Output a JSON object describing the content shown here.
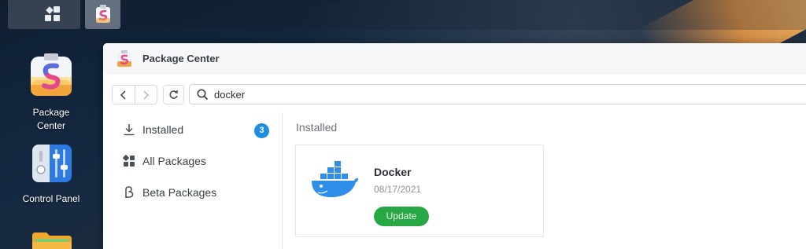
{
  "desktop": {
    "icons": [
      {
        "label_line1": "Package",
        "label_line2": "Center"
      },
      {
        "label_line1": "Control Panel"
      }
    ]
  },
  "window": {
    "title": "Package Center"
  },
  "search": {
    "value": "docker"
  },
  "sidebar": {
    "items": [
      {
        "label": "Installed",
        "badge": "3",
        "icon": "download-icon"
      },
      {
        "label": "All Packages",
        "icon": "grid-icon"
      },
      {
        "label": "Beta Packages",
        "icon": "beta-icon"
      }
    ]
  },
  "main": {
    "section_title": "Installed",
    "packages": [
      {
        "name": "Docker",
        "date": "08/17/2021",
        "action": "Update",
        "icon": "docker-whale-icon"
      }
    ]
  },
  "colors": {
    "accent_blue": "#1f8de0",
    "update_green": "#28a745"
  }
}
